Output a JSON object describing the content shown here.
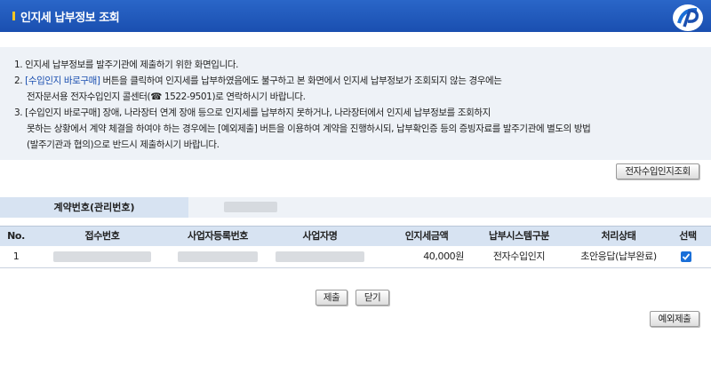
{
  "header": {
    "title": "인지세 납부정보 조회"
  },
  "notice": {
    "line1": "1. 인지세 납부정보를 발주기관에 제출하기 위한 화면입니다.",
    "line2_num": "2. ",
    "line2_hl": "[수입인지 바로구매]",
    "line2_rest": " 버튼을 클릭하여 인지세를 납부하였음에도 불구하고 본 화면에서 인지세 납부정보가 조회되지 않는 경우에는",
    "line3": "전자문서용 전자수입인지 콜센터(☎ 1522-9501)로 연락하시기 바랍니다.",
    "line4": "3. [수입인지 바로구매] 장애, 나라장터 연계 장애 등으로 인지세를 납부하지 못하거나, 나라장터에서 인지세 납부정보를 조회하지",
    "line5": "못하는 상황에서 계약 체결을 하여야 하는 경우에는 [예외제출] 버튼을 이용하여 계약을 진행하시되, 납부확인증 등의 증빙자료를 발주기관에 별도의 방법",
    "line6": "(발주기관과 협의)으로 반드시 제출하시기 바랍니다."
  },
  "buttons": {
    "stamp_lookup": "전자수입인지조회",
    "submit": "제출",
    "close": "닫기",
    "exception_submit": "예외제출"
  },
  "contract": {
    "label": "계약번호(관리번호)"
  },
  "table": {
    "headers": [
      "No.",
      "접수번호",
      "사업자등록번호",
      "사업자명",
      "인지세금액",
      "납부시스템구분",
      "처리상태",
      "선택"
    ],
    "rows": [
      {
        "no": "1",
        "amount": "40,000원",
        "system": "전자수입인지",
        "status": "초안응답(납부완료)",
        "selected": true
      }
    ]
  },
  "colors": {
    "header_bg": "#1a4fb0",
    "accent": "#f3c623",
    "checkbox": "#1a6fd8"
  }
}
